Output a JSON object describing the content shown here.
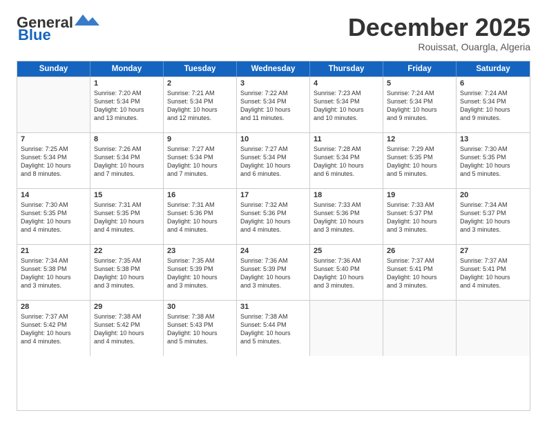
{
  "logo": {
    "line1": "General",
    "line2": "Blue"
  },
  "title": "December 2025",
  "subtitle": "Rouissat, Ouargla, Algeria",
  "header_days": [
    "Sunday",
    "Monday",
    "Tuesday",
    "Wednesday",
    "Thursday",
    "Friday",
    "Saturday"
  ],
  "weeks": [
    [
      {
        "day": "",
        "text": ""
      },
      {
        "day": "1",
        "text": "Sunrise: 7:20 AM\nSunset: 5:34 PM\nDaylight: 10 hours\nand 13 minutes."
      },
      {
        "day": "2",
        "text": "Sunrise: 7:21 AM\nSunset: 5:34 PM\nDaylight: 10 hours\nand 12 minutes."
      },
      {
        "day": "3",
        "text": "Sunrise: 7:22 AM\nSunset: 5:34 PM\nDaylight: 10 hours\nand 11 minutes."
      },
      {
        "day": "4",
        "text": "Sunrise: 7:23 AM\nSunset: 5:34 PM\nDaylight: 10 hours\nand 10 minutes."
      },
      {
        "day": "5",
        "text": "Sunrise: 7:24 AM\nSunset: 5:34 PM\nDaylight: 10 hours\nand 9 minutes."
      },
      {
        "day": "6",
        "text": "Sunrise: 7:24 AM\nSunset: 5:34 PM\nDaylight: 10 hours\nand 9 minutes."
      }
    ],
    [
      {
        "day": "7",
        "text": "Sunrise: 7:25 AM\nSunset: 5:34 PM\nDaylight: 10 hours\nand 8 minutes."
      },
      {
        "day": "8",
        "text": "Sunrise: 7:26 AM\nSunset: 5:34 PM\nDaylight: 10 hours\nand 7 minutes."
      },
      {
        "day": "9",
        "text": "Sunrise: 7:27 AM\nSunset: 5:34 PM\nDaylight: 10 hours\nand 7 minutes."
      },
      {
        "day": "10",
        "text": "Sunrise: 7:27 AM\nSunset: 5:34 PM\nDaylight: 10 hours\nand 6 minutes."
      },
      {
        "day": "11",
        "text": "Sunrise: 7:28 AM\nSunset: 5:34 PM\nDaylight: 10 hours\nand 6 minutes."
      },
      {
        "day": "12",
        "text": "Sunrise: 7:29 AM\nSunset: 5:35 PM\nDaylight: 10 hours\nand 5 minutes."
      },
      {
        "day": "13",
        "text": "Sunrise: 7:30 AM\nSunset: 5:35 PM\nDaylight: 10 hours\nand 5 minutes."
      }
    ],
    [
      {
        "day": "14",
        "text": "Sunrise: 7:30 AM\nSunset: 5:35 PM\nDaylight: 10 hours\nand 4 minutes."
      },
      {
        "day": "15",
        "text": "Sunrise: 7:31 AM\nSunset: 5:35 PM\nDaylight: 10 hours\nand 4 minutes."
      },
      {
        "day": "16",
        "text": "Sunrise: 7:31 AM\nSunset: 5:36 PM\nDaylight: 10 hours\nand 4 minutes."
      },
      {
        "day": "17",
        "text": "Sunrise: 7:32 AM\nSunset: 5:36 PM\nDaylight: 10 hours\nand 4 minutes."
      },
      {
        "day": "18",
        "text": "Sunrise: 7:33 AM\nSunset: 5:36 PM\nDaylight: 10 hours\nand 3 minutes."
      },
      {
        "day": "19",
        "text": "Sunrise: 7:33 AM\nSunset: 5:37 PM\nDaylight: 10 hours\nand 3 minutes."
      },
      {
        "day": "20",
        "text": "Sunrise: 7:34 AM\nSunset: 5:37 PM\nDaylight: 10 hours\nand 3 minutes."
      }
    ],
    [
      {
        "day": "21",
        "text": "Sunrise: 7:34 AM\nSunset: 5:38 PM\nDaylight: 10 hours\nand 3 minutes."
      },
      {
        "day": "22",
        "text": "Sunrise: 7:35 AM\nSunset: 5:38 PM\nDaylight: 10 hours\nand 3 minutes."
      },
      {
        "day": "23",
        "text": "Sunrise: 7:35 AM\nSunset: 5:39 PM\nDaylight: 10 hours\nand 3 minutes."
      },
      {
        "day": "24",
        "text": "Sunrise: 7:36 AM\nSunset: 5:39 PM\nDaylight: 10 hours\nand 3 minutes."
      },
      {
        "day": "25",
        "text": "Sunrise: 7:36 AM\nSunset: 5:40 PM\nDaylight: 10 hours\nand 3 minutes."
      },
      {
        "day": "26",
        "text": "Sunrise: 7:37 AM\nSunset: 5:41 PM\nDaylight: 10 hours\nand 3 minutes."
      },
      {
        "day": "27",
        "text": "Sunrise: 7:37 AM\nSunset: 5:41 PM\nDaylight: 10 hours\nand 4 minutes."
      }
    ],
    [
      {
        "day": "28",
        "text": "Sunrise: 7:37 AM\nSunset: 5:42 PM\nDaylight: 10 hours\nand 4 minutes."
      },
      {
        "day": "29",
        "text": "Sunrise: 7:38 AM\nSunset: 5:42 PM\nDaylight: 10 hours\nand 4 minutes."
      },
      {
        "day": "30",
        "text": "Sunrise: 7:38 AM\nSunset: 5:43 PM\nDaylight: 10 hours\nand 5 minutes."
      },
      {
        "day": "31",
        "text": "Sunrise: 7:38 AM\nSunset: 5:44 PM\nDaylight: 10 hours\nand 5 minutes."
      },
      {
        "day": "",
        "text": ""
      },
      {
        "day": "",
        "text": ""
      },
      {
        "day": "",
        "text": ""
      }
    ]
  ]
}
